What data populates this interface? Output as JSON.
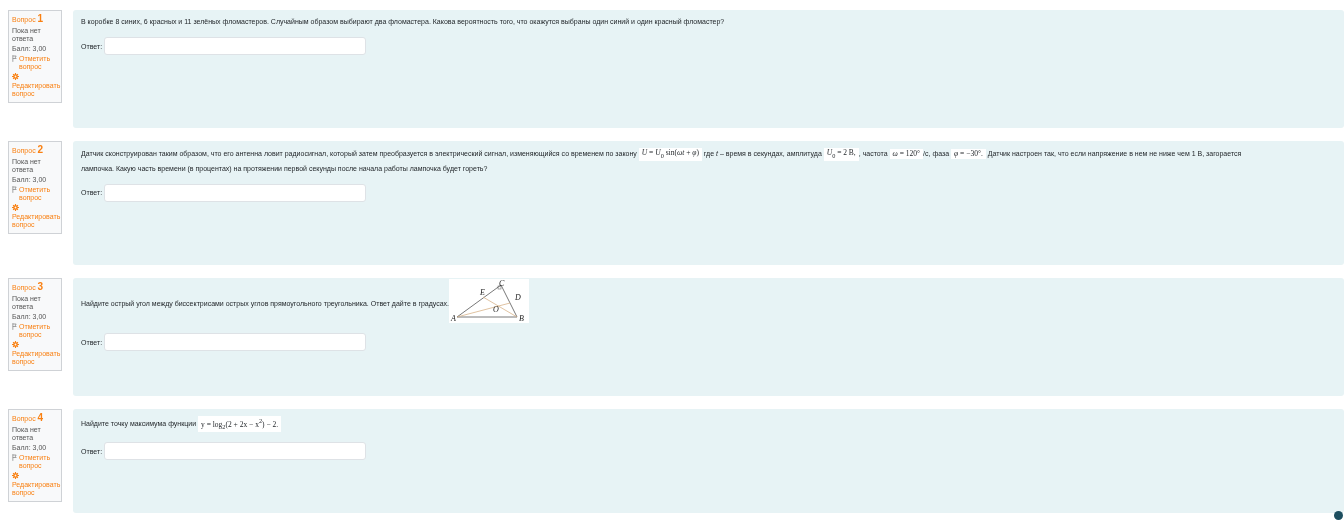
{
  "questions": [
    {
      "label": "Вопрос",
      "number": "1",
      "status": "Пока нет ответа",
      "grade": "Балл: 3,00",
      "flag_link": "Отметить вопрос",
      "edit_link": "Редактировать вопрос",
      "answer_label": "Ответ:",
      "lines": [
        [
          {
            "kind": "text",
            "text": "В коробке 8 синих, 6 красных и 11 зелёных фломастеров. Случайным образом выбирают два фломастера. Какова вероятность того, что окажутся выбраны один синий и один красный фломастер?"
          }
        ]
      ]
    },
    {
      "label": "Вопрос",
      "number": "2",
      "status": "Пока нет ответа",
      "grade": "Балл: 3,00",
      "flag_link": "Отметить вопрос",
      "edit_link": "Редактировать вопрос",
      "answer_label": "Ответ:",
      "lines": [
        [
          {
            "kind": "text",
            "text": "Датчик сконструирован таким образом, что его антенна ловит радиосигнал, который затем преобразуется в электрический сигнал, изменяющийся со временем по закону "
          },
          {
            "kind": "formula",
            "text": "*U* = *U*$_{0}$ sin(*ωt* + *φ*)"
          },
          {
            "kind": "text",
            "text": " где *t* – время в секундах, амплитуда "
          },
          {
            "kind": "formula",
            "text": "*U*$_{0}$ = 2 В,"
          },
          {
            "kind": "text",
            "text": ", частота "
          },
          {
            "kind": "formula",
            "text": "*ω* = 120°"
          },
          {
            "kind": "text",
            "text": "/с, фаза "
          },
          {
            "kind": "formula",
            "text": "*φ* = −30°."
          },
          {
            "kind": "text",
            "text": " Датчик настроен так, что если напряжение в нем не ниже чем 1 В, загорается"
          }
        ],
        [
          {
            "kind": "text",
            "text": "лампочка. Какую часть времени (в процентах) на протяжении первой секунды после начала работы лампочка будет гореть?"
          }
        ]
      ]
    },
    {
      "label": "Вопрос",
      "number": "3",
      "status": "Пока нет ответа",
      "grade": "Балл: 3,00",
      "flag_link": "Отметить вопрос",
      "edit_link": "Редактировать вопрос",
      "answer_label": "Ответ:",
      "lines": [
        [
          {
            "kind": "text",
            "text": "Найдите острый угол между биссектрисами острых углов прямоугольного треугольника. Ответ дайте в градусах."
          },
          {
            "kind": "figure",
            "labels": [
              "C",
              "E",
              "D",
              "O",
              "A",
              "B"
            ]
          }
        ]
      ]
    },
    {
      "label": "Вопрос",
      "number": "4",
      "status": "Пока нет ответа",
      "grade": "Балл: 3,00",
      "flag_link": "Отметить вопрос",
      "edit_link": "Редактировать вопрос",
      "answer_label": "Ответ:",
      "lines": [
        [
          {
            "kind": "text",
            "text": "Найдите точку максимума функции "
          },
          {
            "kind": "formula",
            "text": "y = log$_{2}$(2 + 2x − x$^{2}$) − 2."
          }
        ]
      ]
    }
  ]
}
